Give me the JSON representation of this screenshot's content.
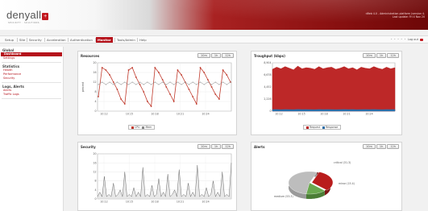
{
  "header": {
    "logo_text": "denyall",
    "logo_box": "+",
    "logo_sub": "SECURITY · SOLUTIONS",
    "version_line1": "rWeb 4.0 - Administration platform (version 4.",
    "version_line2": "Last update: Fri 4 Nov 20"
  },
  "menu": {
    "items": [
      "Setup",
      "Site",
      "Security",
      "Acceleration",
      "Authentication",
      "Monitor",
      "Tools/Admin",
      "Help"
    ],
    "active": "Monitor",
    "dots": "• • • • •",
    "logout_label": "Log out"
  },
  "sidebar": {
    "sections": [
      {
        "title": "Global",
        "items": [
          "Dashboard",
          "Settings"
        ]
      },
      {
        "title": "Statistics",
        "items": [
          "Health",
          "Performance",
          "Security"
        ]
      },
      {
        "title": "Logs, Alerts",
        "items": [
          "Alerts",
          "Traffic Logs"
        ]
      }
    ],
    "active_item": "Dashboard"
  },
  "range_buttons": [
    "10m",
    "1h",
    "12h"
  ],
  "colors": {
    "brand_red": "#b5121b",
    "cpu": "#c0392b",
    "mem": "#888888",
    "request": "#b91c1c",
    "response": "#2c6ea8",
    "security_line": "#6b6b6b",
    "pie_medium": "#bdbdbd",
    "pie_critical": "#b91c1c",
    "pie_minor": "#6aa84f"
  },
  "panels": {
    "resources": {
      "title": "Resources",
      "legend": [
        "CPU",
        "Mem"
      ]
    },
    "throughput": {
      "title": "Troughput (kbps)",
      "legend": [
        "Request",
        "Response"
      ]
    },
    "security": {
      "title": "Security"
    },
    "alerts": {
      "title": "Alerts"
    }
  },
  "chart_data": [
    {
      "type": "line",
      "title": "Resources",
      "ylabel": "percent",
      "ylim": [
        0,
        20
      ],
      "y_ticks": [
        "0",
        "4",
        "8",
        "12",
        "16",
        "20"
      ],
      "x_ticks": [
        "10:12",
        "10:15",
        "10:18",
        "10:21",
        "10:24"
      ],
      "series": [
        {
          "name": "CPU",
          "values": [
            6,
            18,
            17,
            15,
            12,
            9,
            5,
            3,
            17,
            18,
            14,
            11,
            8,
            4,
            2,
            18,
            16,
            13,
            10,
            7,
            4,
            17,
            15,
            12,
            9,
            6,
            3,
            18,
            16,
            13,
            10,
            7,
            5,
            17,
            15,
            12
          ]
        },
        {
          "name": "Mem",
          "values": [
            11,
            12,
            11,
            12,
            11,
            12,
            11,
            12,
            11,
            12,
            11,
            12,
            11,
            12,
            11,
            12,
            11,
            12,
            11,
            12,
            11,
            12,
            11,
            12,
            11,
            12,
            11,
            12,
            11,
            12,
            11,
            12,
            11,
            12,
            11,
            12
          ]
        }
      ]
    },
    {
      "type": "area",
      "title": "Troughput (kbps)",
      "ylim": [
        0,
        9000
      ],
      "y_ticks": [
        "0",
        "2,226",
        "4,452",
        "6,678",
        "8,904"
      ],
      "x_ticks": [
        "10:12",
        "10:15",
        "10:18",
        "10:21",
        "10:24"
      ],
      "series": [
        {
          "name": "Request",
          "values": [
            7800,
            8200,
            7900,
            8300,
            8000,
            7700,
            8400,
            7900,
            8100,
            8000,
            7800,
            8300,
            7900,
            8100,
            8200,
            7800,
            8000,
            8300,
            7900,
            8100,
            7700,
            8200,
            8000,
            7900,
            8300,
            8000,
            7800,
            8200,
            7900,
            8100
          ]
        },
        {
          "name": "Response",
          "values": [
            300,
            320,
            280,
            310,
            300,
            290,
            330,
            300,
            310,
            300,
            290,
            320,
            300,
            310,
            300,
            290,
            300,
            320,
            300,
            310,
            290,
            300,
            310,
            300,
            320,
            300,
            290,
            310,
            300,
            310
          ]
        }
      ]
    },
    {
      "type": "line",
      "title": "Security",
      "ylim": [
        0,
        20
      ],
      "y_ticks": [
        "0",
        "4",
        "8",
        "12",
        "16",
        "20"
      ],
      "x_ticks": [
        "10:12",
        "10:15",
        "10:18",
        "10:21",
        "10:24"
      ],
      "series": [
        {
          "name": "Security",
          "values": [
            1,
            3,
            1,
            10,
            1,
            2,
            1,
            7,
            1,
            2,
            4,
            1,
            12,
            1,
            2,
            1,
            5,
            1,
            3,
            1,
            14,
            1,
            2,
            1,
            6,
            1,
            2,
            9,
            1,
            3,
            1,
            11,
            1,
            2,
            4,
            1,
            13,
            1,
            2,
            1,
            7,
            1,
            3,
            1,
            15,
            1,
            2,
            1,
            5,
            1,
            2,
            8,
            1,
            3,
            1,
            12,
            1,
            2,
            1,
            16
          ]
        }
      ]
    },
    {
      "type": "pie",
      "title": "Alerts",
      "slices": [
        {
          "label": "medium (53.3)",
          "value": 53.3
        },
        {
          "label": "critical (31.3)",
          "value": 31.3
        },
        {
          "label": "minor (15.4)",
          "value": 15.4
        }
      ]
    }
  ]
}
